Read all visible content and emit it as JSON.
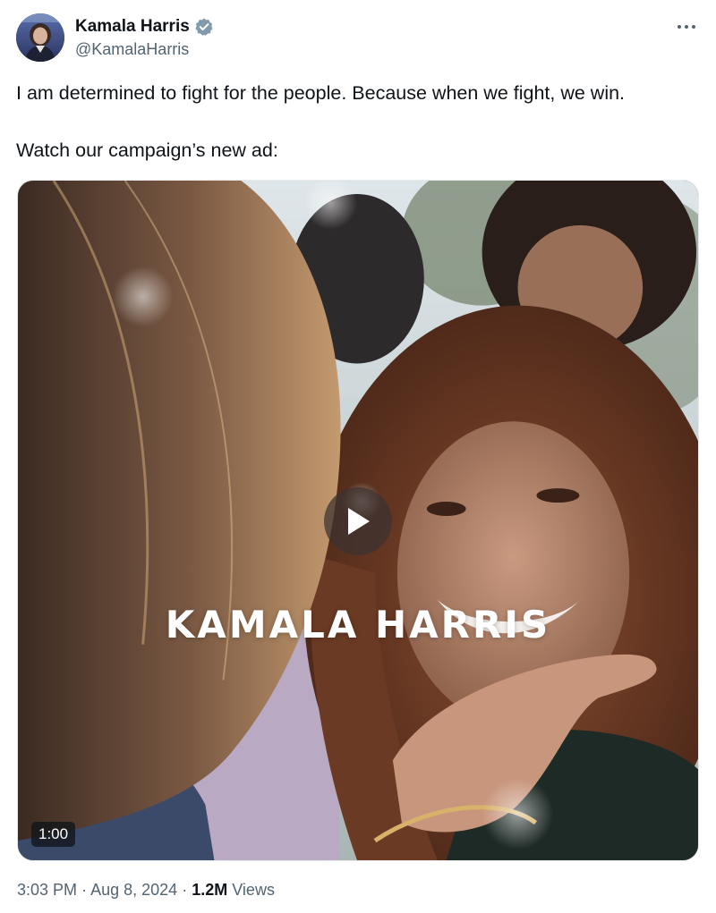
{
  "author": {
    "display_name": "Kamala Harris",
    "handle": "@KamalaHarris",
    "verified_badge_color": "#829aab",
    "avatar_icon": "profile-photo"
  },
  "more_icon": "ellipsis-horizontal-icon",
  "tweet": {
    "line1": "I am determined to fight for the people. Because when we fight, we win.",
    "line2": "Watch our campaign’s new ad:"
  },
  "media": {
    "type": "video",
    "overlay_text": "KAMALA HARRIS",
    "duration": "1:00",
    "play_icon": "play-icon"
  },
  "meta": {
    "time": "3:03 PM",
    "separator": "·",
    "date": "Aug 8, 2024",
    "views_count": "1.2M",
    "views_label": "Views"
  },
  "colors": {
    "text_primary": "#0f1419",
    "text_secondary": "#536471",
    "badge_bg": "#0f1419"
  }
}
